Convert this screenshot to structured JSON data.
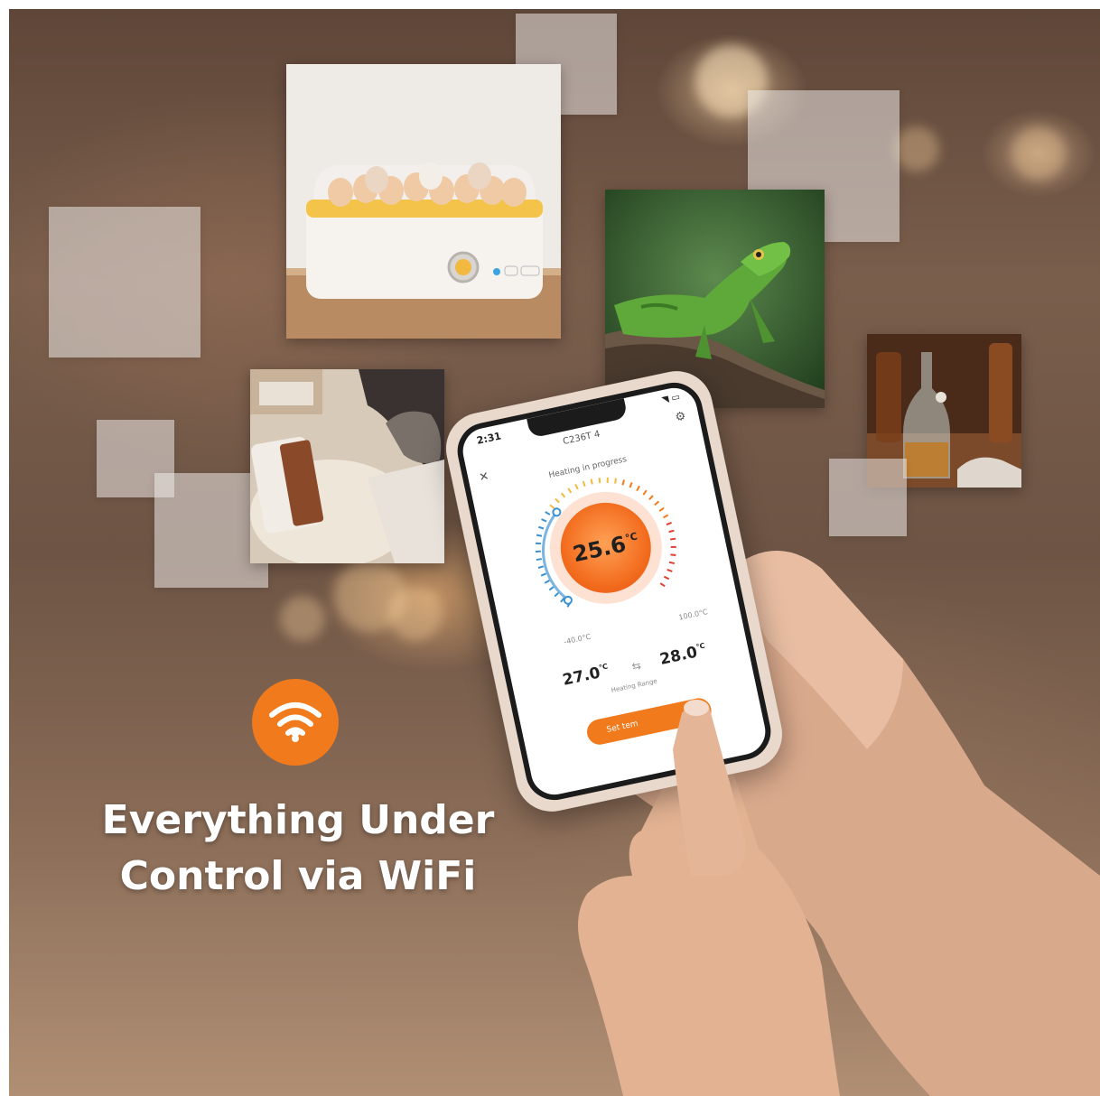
{
  "headline": {
    "line1": "Everything Under",
    "line2": "Control via WiFi"
  },
  "icons": {
    "wifi": "wifi-icon",
    "close": "close-icon",
    "settings": "gear-icon",
    "swap": "swap-arrows-icon"
  },
  "colors": {
    "accent": "#f07a1c",
    "text_on_accent": "#ffffff"
  },
  "app": {
    "status_time": "2:31",
    "device_name": "C236T 4",
    "status": "Heating in progress",
    "current_temp": "25.6",
    "unit": "°C",
    "dial_min": "-40.0°C",
    "dial_max": "100.0°C",
    "range_low": "27.0",
    "range_high": "28.0",
    "range_label": "Heating Range",
    "button_label": "Set tem"
  },
  "photos": [
    "egg-incubator-photo",
    "iguana-photo",
    "space-heater-with-cat-photo",
    "fermentation-bottles-photo"
  ]
}
